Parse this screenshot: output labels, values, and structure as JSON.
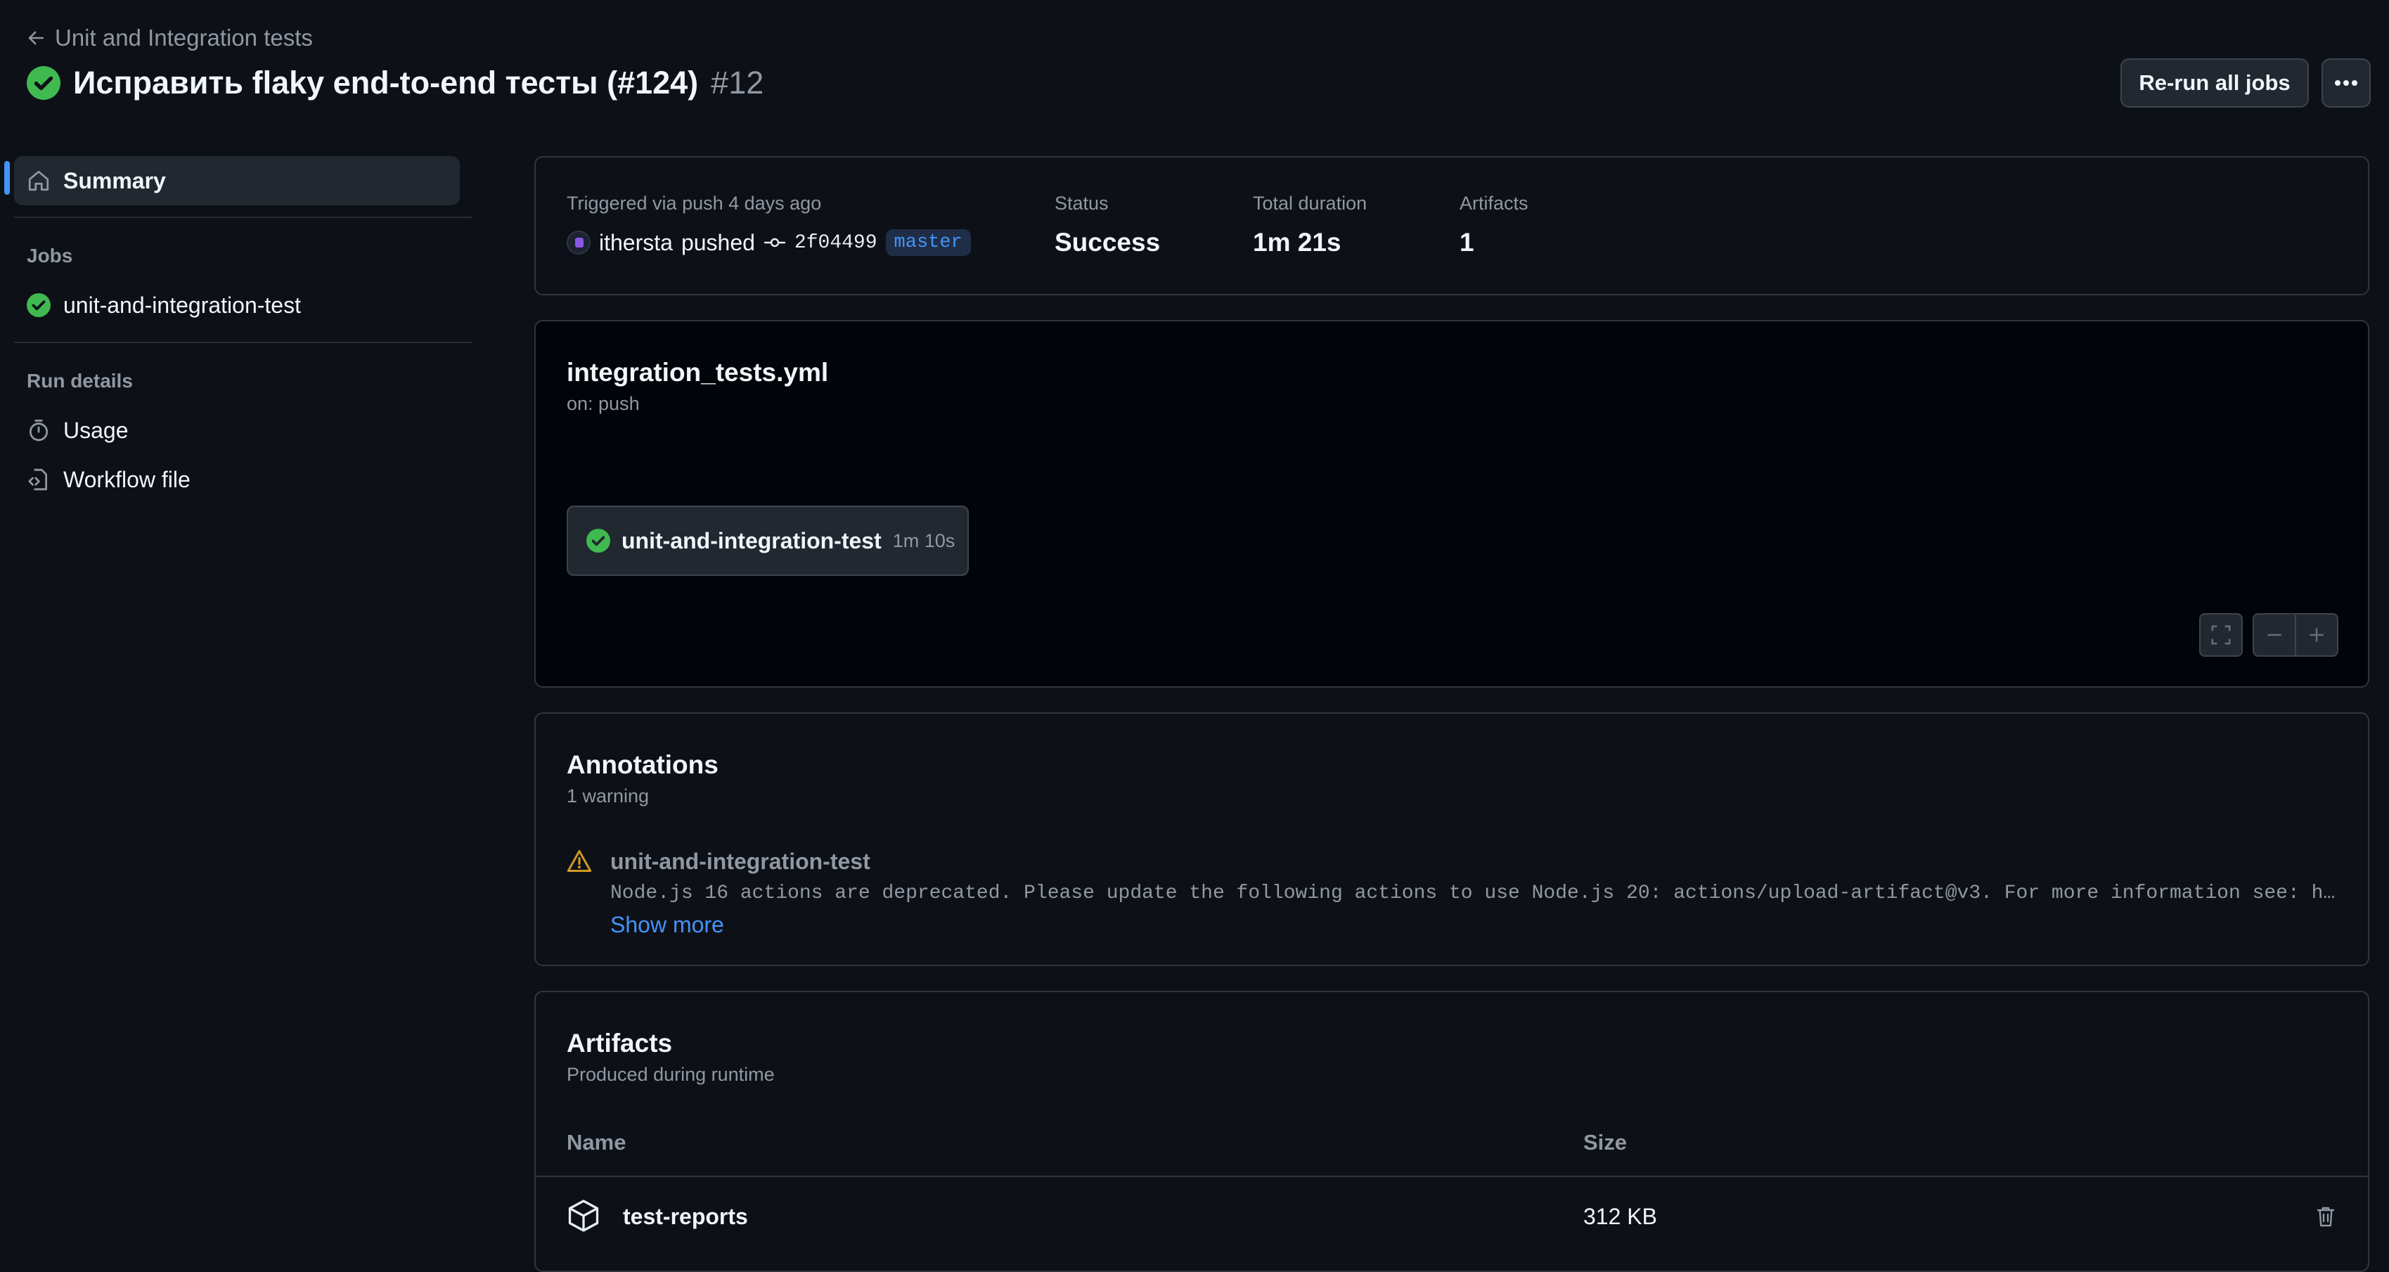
{
  "header": {
    "back_label": "Unit and Integration tests",
    "title": "Исправить flaky end-to-end тесты (#124)",
    "run_number": "#12",
    "rerun_label": "Re-run all jobs"
  },
  "sidebar": {
    "summary_label": "Summary",
    "jobs_heading": "Jobs",
    "job_name": "unit-and-integration-test",
    "run_details_heading": "Run details",
    "usage_label": "Usage",
    "workflow_file_label": "Workflow file"
  },
  "summary": {
    "trigger_label": "Triggered via push 4 days ago",
    "actor": "ithersta",
    "action": "pushed",
    "commit": "2f04499",
    "branch": "master",
    "status_label": "Status",
    "status_value": "Success",
    "duration_label": "Total duration",
    "duration_value": "1m 21s",
    "artifacts_label": "Artifacts",
    "artifacts_value": "1"
  },
  "workflow": {
    "file": "integration_tests.yml",
    "trigger": "on: push",
    "job_name": "unit-and-integration-test",
    "job_duration": "1m 10s"
  },
  "annotations": {
    "title": "Annotations",
    "count": "1 warning",
    "items": [
      {
        "job": "unit-and-integration-test",
        "message": "Node.js 16 actions are deprecated. Please update the following actions to use Node.js 20: actions/upload-artifact@v3. For more information see: https://gi…",
        "show_more": "Show more"
      }
    ]
  },
  "artifacts": {
    "title": "Artifacts",
    "subtitle": "Produced during runtime",
    "col_name": "Name",
    "col_size": "Size",
    "rows": [
      {
        "name": "test-reports",
        "size": "312 KB"
      }
    ]
  },
  "colors": {
    "success": "#3fb950",
    "warning": "#d29922",
    "accent": "#4493f8",
    "background": "#0d1117"
  }
}
